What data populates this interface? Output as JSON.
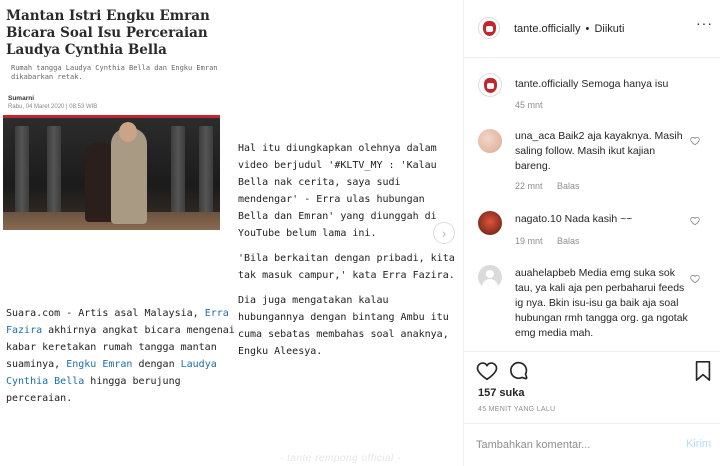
{
  "article": {
    "title": "Mantan Istri Engku Emran Bicara Soal Isu Perceraian Laudya Cynthia Bella",
    "subtitle": "Rumah tangga Laudya Cynthia Bella dan Engku Emran dikabarkan retak.",
    "author": "Sumarni",
    "date": "Rabu, 04 Maret 2020 | 08:53 WIB",
    "left_p_prefix": "Suara.com - Artis asal Malaysia, ",
    "left_link1": "Erra Fazira",
    "left_p_mid1": " akhirnya angkat bicara mengenai kabar keretakan rumah tangga mantan suaminya, ",
    "left_link2": "Engku Emran",
    "left_p_mid2": " dengan ",
    "left_link3": "Laudya Cynthia Bella",
    "left_p_end": " hingga berujung perceraian.",
    "right_p1": "Hal itu diungkapkan olehnya dalam video berjudul '#KLTV_MY : 'Kalau Bella nak cerita, saya sudi mendengar' - Erra ulas hubungan Bella dan Emran' yang diunggah di YouTube belum lama ini.",
    "right_p2": "'Bila berkaitan dengan pribadi, kita tak masuk campur,' kata Erra Fazira.",
    "right_p3": "Dia juga mengatakan kalau hubungannya dengan bintang Ambu itu cuma sebatas membahas soal anaknya, Engku Aleesya.",
    "watermark": "- tante rempong official -",
    "next_arrow": "›"
  },
  "header": {
    "username": "tante.officially",
    "separator": "•",
    "follow_status": "Diikuti",
    "more": "···"
  },
  "comments": [
    {
      "user": "tante.officially",
      "text": "Semoga hanya isu",
      "time": "45 mnt",
      "reply": ""
    },
    {
      "user": "una_aca",
      "text": "Baik2 aja kayaknya. Masih saling follow. Masih ikut kajian bareng.",
      "time": "22 mnt",
      "reply": "Balas"
    },
    {
      "user": "nagato.10",
      "text": "Nada kasih ~~",
      "time": "19 mnt",
      "reply": "Balas"
    },
    {
      "user": "auahelapbeb",
      "text": "Media emg suka sok tau, ya kali aja pen perbaharui feeds ig nya. Bkin isu-isu ga baik aja soal hubungan rmh tangga org. ga ngotak emg media mah.",
      "time": "",
      "reply": ""
    }
  ],
  "actions": {
    "likes": "157 suka",
    "time_ago": "45 MENIT YANG LALU"
  },
  "add_comment": {
    "placeholder": "Tambahkan komentar...",
    "post_label": "Kirim"
  },
  "colors": {
    "link": "#1f6fa8",
    "accent_red": "#c0262d",
    "post_button_disabled": "#b3dbff",
    "meta_gray": "#8e8e8e"
  }
}
